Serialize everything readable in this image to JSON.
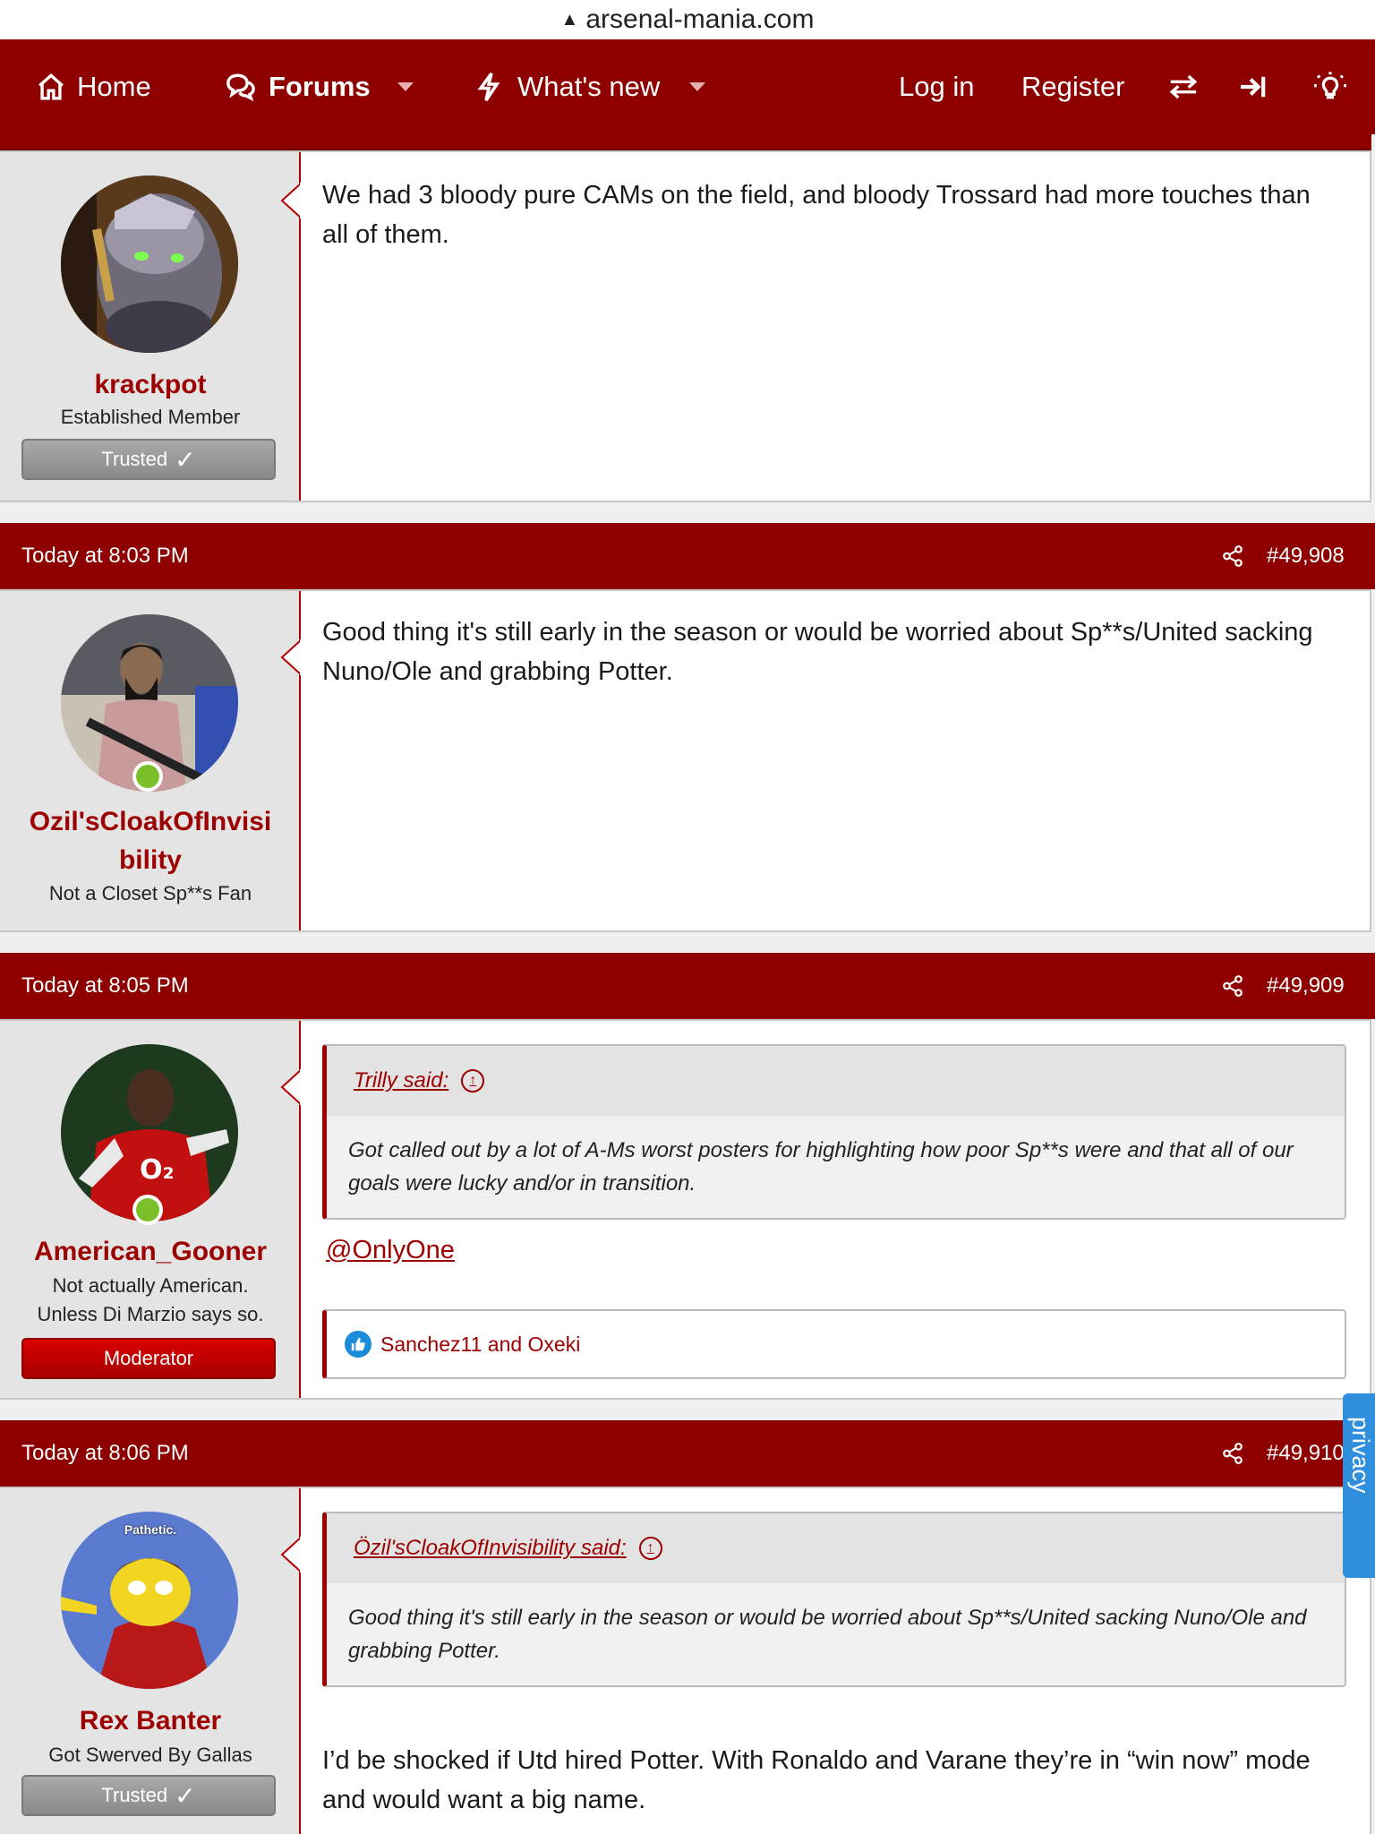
{
  "browser": {
    "url": "arsenal-mania.com"
  },
  "nav": {
    "home": "Home",
    "forums": "Forums",
    "whats_new": "What's new",
    "login": "Log in",
    "register": "Register"
  },
  "posts": [
    {
      "username": "krackpot",
      "title": "Established Member",
      "badge": "Trusted",
      "message": "We had 3 bloody pure CAMs on the field, and bloody Trossard had more touches than all of them."
    },
    {
      "date": "Today at 8:03 PM",
      "number": "#49,908",
      "username_line1": "Ozil'sCloakOfInvisi",
      "username_line2": "bility",
      "title": "Not a Closet Sp**s Fan",
      "message": "Good thing it's still early in the season or would be worried about Sp**s/United sacking Nuno/Ole and grabbing Potter."
    },
    {
      "date": "Today at 8:05 PM",
      "number": "#49,909",
      "username": "American_Gooner",
      "title_line1": "Not actually American.",
      "title_line2": "Unless Di Marzio says so.",
      "badge": "Moderator",
      "quote_author": "Trilly said:",
      "quote_text": "Got called out by a lot of A-Ms worst posters for highlighting how poor Sp**s were and that all of our goals were lucky and/or in transition.",
      "mention": "@OnlyOne",
      "reactions": "Sanchez11 and Oxeki"
    },
    {
      "date": "Today at 8:06 PM",
      "number": "#49,910",
      "username": "Rex Banter",
      "title": "Got Swerved By Gallas",
      "badge": "Trusted",
      "avatar_caption": "Pathetic.",
      "quote_author": "Özil'sCloakOfInvisibility said:",
      "quote_text": "Good thing it's still early in the season or would be worried about Sp**s/United sacking Nuno/Ole and grabbing Potter.",
      "message": "I’d be shocked if Utd hired Potter. With Ronaldo and Varane they’re in “win now” mode and would want a big name."
    }
  ],
  "privacy": {
    "label": "privacy"
  },
  "colors": {
    "brand": "#8e0000",
    "link": "#9c0000",
    "online": "#7bbf2a",
    "privacy": "#2f8fdd"
  }
}
